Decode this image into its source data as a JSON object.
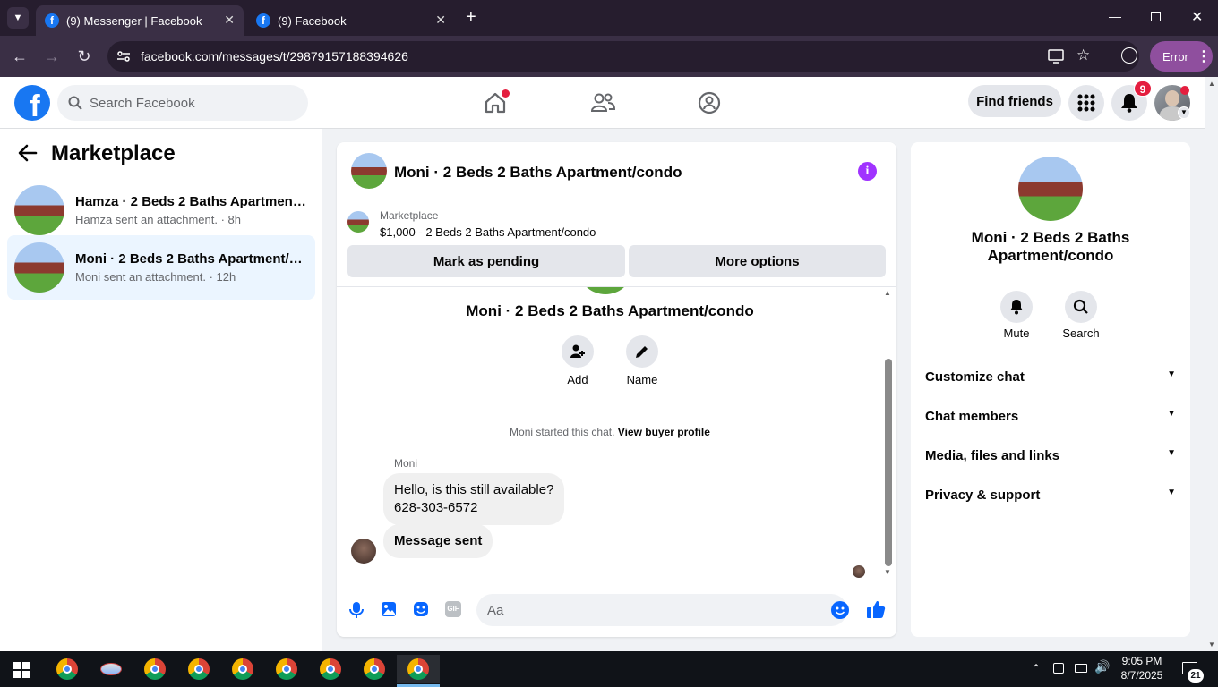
{
  "browser": {
    "tabs": [
      {
        "label": "(9) Messenger | Facebook",
        "active": true
      },
      {
        "label": "(9) Facebook",
        "active": false
      }
    ],
    "url": "facebook.com/messages/t/29879157188394626",
    "profile_button": "Error"
  },
  "fb_header": {
    "search_placeholder": "Search Facebook",
    "find_friends": "Find friends",
    "notification_count": "9"
  },
  "left_panel": {
    "title": "Marketplace",
    "conversations": [
      {
        "title": "Hamza · 2 Beds 2 Baths Apartment/condo",
        "subtitle": "Hamza sent an attachment. · 8h",
        "selected": false
      },
      {
        "title": "Moni · 2 Beds 2 Baths Apartment/condo",
        "subtitle": "Moni sent an attachment. · 12h",
        "selected": true
      }
    ]
  },
  "chat": {
    "title": "Moni · 2 Beds 2 Baths Apartment/condo",
    "marketplace_label": "Marketplace",
    "listing": "$1,000 - 2 Beds 2 Baths Apartment/condo",
    "mark_pending": "Mark as pending",
    "more_options": "More options",
    "intro_title": "Moni · 2 Beds 2 Baths Apartment/condo",
    "add_label": "Add",
    "name_label": "Name",
    "started_text": "Moni started this chat.",
    "view_profile": "View buyer profile",
    "sender": "Moni",
    "messages": [
      "Hello, is this still available?",
      "628-303-6572",
      "Message sent"
    ],
    "composer_placeholder": "Aa"
  },
  "right_panel": {
    "title": "Moni · 2 Beds 2 Baths Apartment/condo",
    "mute": "Mute",
    "search": "Search",
    "sections": [
      "Customize chat",
      "Chat members",
      "Media, files and links",
      "Privacy & support"
    ]
  },
  "taskbar": {
    "time": "9:05 PM",
    "date": "8/7/2025",
    "notifications": "21"
  },
  "colors": {
    "fb_blue": "#1877f2",
    "messenger_purple": "#a033ff"
  }
}
